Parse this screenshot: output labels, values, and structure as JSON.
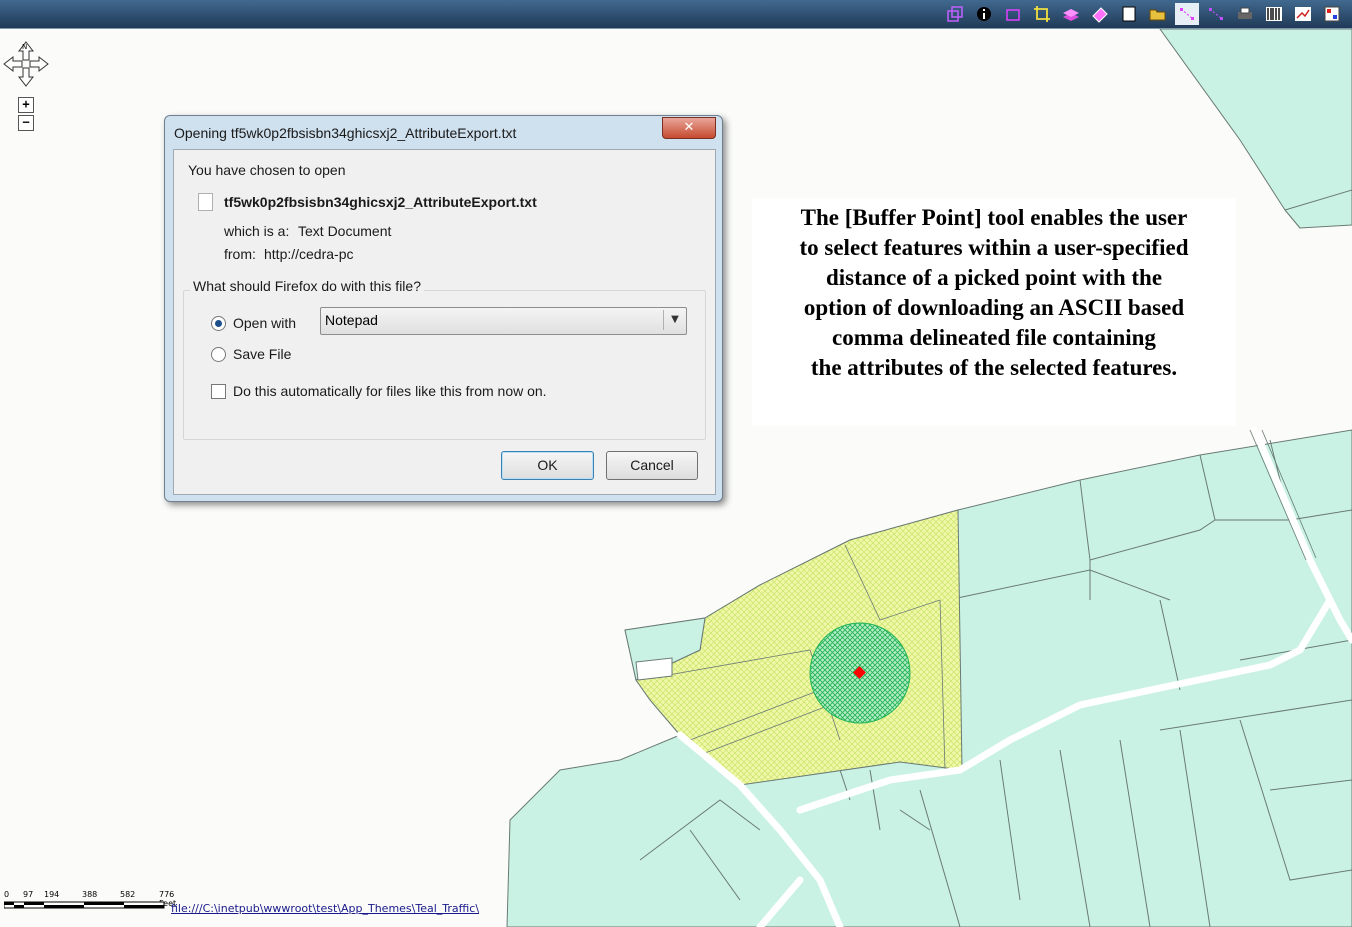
{
  "toolbar": {
    "tools": [
      "layers-icon",
      "info-icon",
      "select-box-icon",
      "crop-icon",
      "layer-stack-icon",
      "eraser-icon",
      "white-panel-icon",
      "open-folder-icon",
      "select-points-icon",
      "select-lines-icon",
      "print-icon",
      "barcode-icon",
      "chart-icon",
      "palette-icon"
    ],
    "active_tool": "select-points-icon"
  },
  "map_nav": {
    "zoom_in": "+",
    "zoom_out": "−",
    "pan_center": "N"
  },
  "dialog": {
    "title": "Opening tf5wk0p2fbsisbn34ghicsxj2_AttributeExport.txt",
    "close": "✕",
    "chosen_label": "You have chosen to open",
    "filename": "tf5wk0p2fbsisbn34ghicsxj2_AttributeExport.txt",
    "which_is_label": "which is a:",
    "which_is_value": "Text Document",
    "from_label": "from:",
    "from_value": "http://cedra-pc",
    "question": "What should Firefox do with this file?",
    "open_with_label": "Open with",
    "open_with_value": "Notepad",
    "save_file_label": "Save File",
    "auto_label": "Do this automatically for files like this from now on.",
    "ok": "OK",
    "cancel": "Cancel"
  },
  "annotation": [
    "The [Buffer Point] tool enables the user",
    "to select features within a user-specified",
    "distance of a picked point with the",
    "option of downloading an ASCII based",
    "comma delineated file containing",
    "the attributes of the selected features."
  ],
  "scale": {
    "labels": [
      "0",
      "97",
      "194",
      "388",
      "582",
      "776 Feet"
    ]
  },
  "footer": {
    "file_path": "file:///C:\\inetpub\\wwwroot\\test\\App_Themes\\Teal_Traffic\\"
  },
  "colors": {
    "parcel": "#c9f2e5",
    "selected": "#f0f8a8",
    "buffer": "#3cc96a",
    "point": "#ff0000",
    "road": "#ffffff"
  }
}
